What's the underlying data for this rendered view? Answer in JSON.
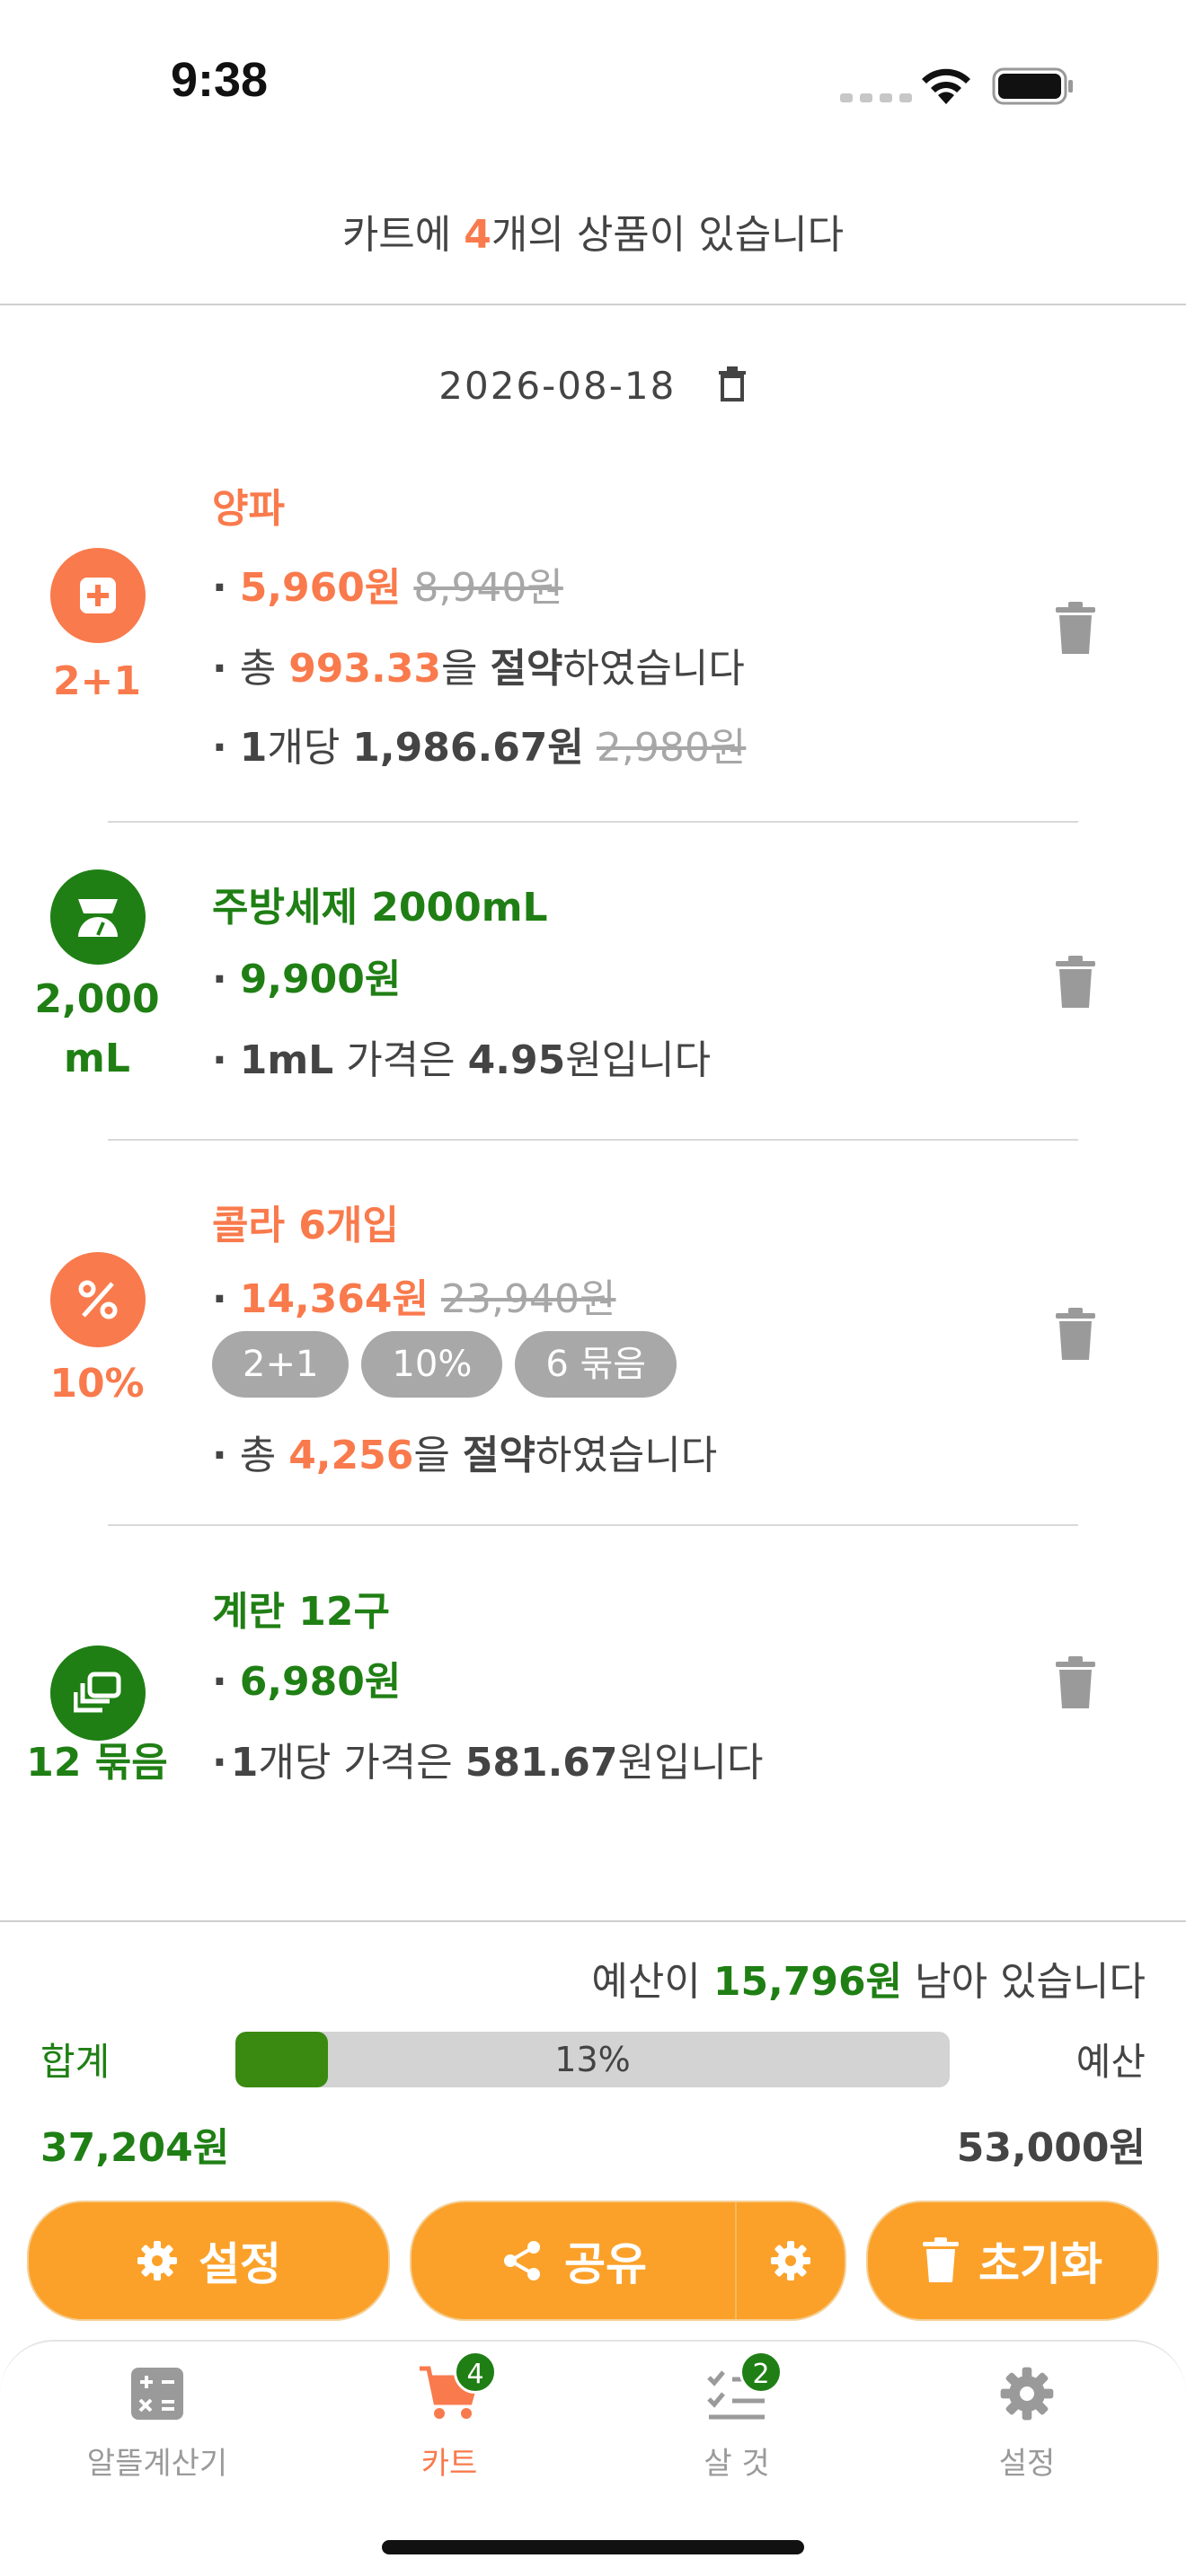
{
  "status_bar": {
    "time": "9:38"
  },
  "header": {
    "prefix": "카트에 ",
    "count": "4",
    "suffix": "개의 상품이 있습니다"
  },
  "date": "2026-08-18",
  "items": [
    {
      "name": "양파",
      "badge": "2+1",
      "badge_icon": "plus-square-icon",
      "color": "#F97A4C",
      "price": "5,960원",
      "original_price": "8,940원",
      "save_prefix": "총 ",
      "save_value": "993.33",
      "save_mid": "을 ",
      "save_bold": "절약",
      "save_suffix": "하였습니다",
      "unit_prefix": "1",
      "unit_mid": "개당 ",
      "unit_price": "1,986.67원",
      "unit_original": "2,980원"
    },
    {
      "name": "주방세제 2000mL",
      "badge_line1": "2,000",
      "badge_line2": "mL",
      "badge_icon": "scale-icon",
      "color": "#1F7F14",
      "price": "9,900원",
      "unit_bold": "1mL",
      "unit_mid": " 가격은 ",
      "unit_value": "4.95",
      "unit_suffix": "원입니다"
    },
    {
      "name": "콜라 6개입",
      "badge": "10%",
      "badge_icon": "percent-icon",
      "color": "#F97A4C",
      "price": "14,364원",
      "original_price": "23,940원",
      "chips": [
        "2+1",
        "10%",
        "6 묶음"
      ],
      "save_prefix": "총 ",
      "save_value": "4,256",
      "save_mid": "을 ",
      "save_bold": "절약",
      "save_suffix": "하였습니다"
    },
    {
      "name": "계란 12구",
      "badge": "12 묶음",
      "badge_icon": "bundle-icon",
      "color": "#1F7F14",
      "price": "6,980원",
      "unit_prefix": "1",
      "unit_mid": "개당 가격은 ",
      "unit_value": "581.67",
      "unit_suffix": "원입니다"
    }
  ],
  "summary": {
    "remaining_prefix": "예산이 ",
    "remaining_value": "15,796원",
    "remaining_suffix": " 남아 있습니다",
    "sum_label": "합계",
    "budget_label": "예산",
    "progress_text": "13%",
    "progress_fraction": 0.13,
    "sum_value": "37,204원",
    "budget_value": "53,000원"
  },
  "buttons": {
    "settings": "설정",
    "share": "공유",
    "reset": "초기화"
  },
  "tabs": [
    {
      "label": "알뜰계산기",
      "icon": "calculator-icon"
    },
    {
      "label": "카트",
      "icon": "cart-icon",
      "badge": "4"
    },
    {
      "label": "살 것",
      "icon": "checklist-icon",
      "badge": "2"
    },
    {
      "label": "설정",
      "icon": "gear-icon"
    }
  ],
  "colors": {
    "orange": "#F97A4C",
    "green": "#1F7F14",
    "button": "#FBA12A"
  }
}
